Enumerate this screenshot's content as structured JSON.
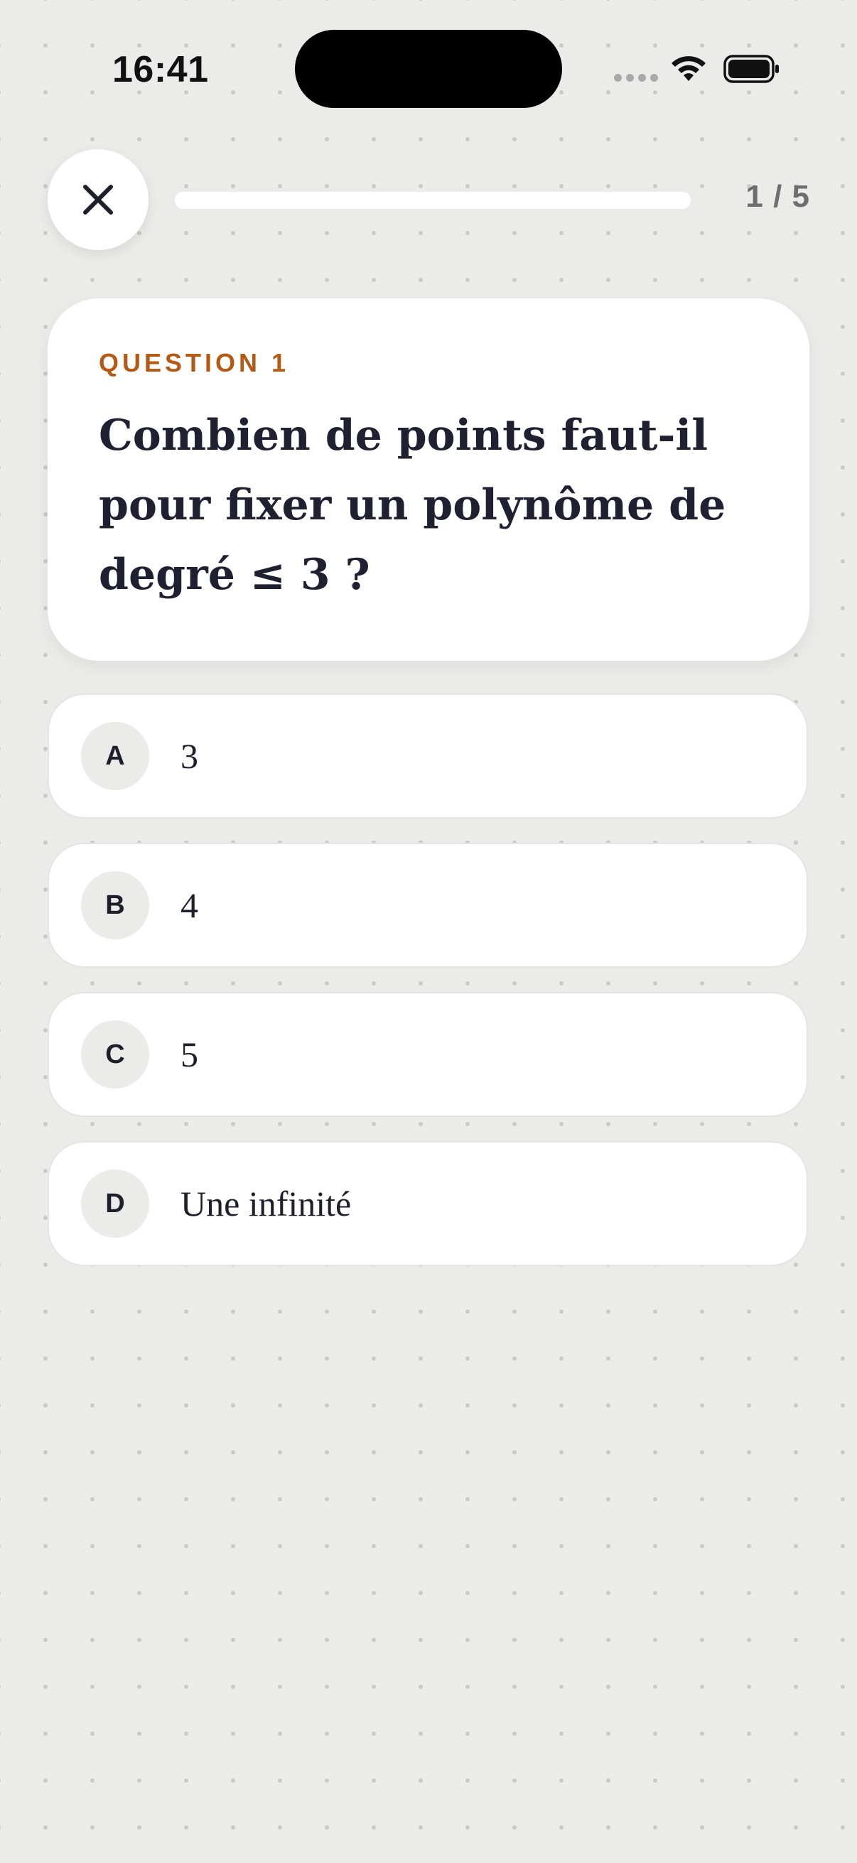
{
  "status_bar": {
    "time": "16:41"
  },
  "header": {
    "progress_counter": "1 / 5",
    "progress_fraction": 0.2
  },
  "question": {
    "label": "QUESTION 1",
    "text": "Combien de points faut-il pour fixer un polynôme de degré ≤ 3 ?"
  },
  "options": [
    {
      "letter": "A",
      "text": "3"
    },
    {
      "letter": "B",
      "text": "4"
    },
    {
      "letter": "C",
      "text": "5"
    },
    {
      "letter": "D",
      "text": "Une infinité"
    }
  ]
}
